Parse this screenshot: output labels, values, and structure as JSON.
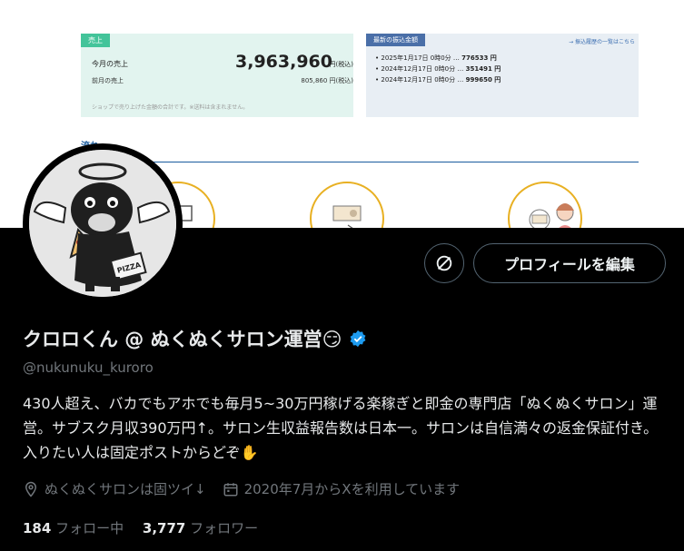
{
  "banner": {
    "sales_tag": "売上",
    "this_month_label": "今月の売上",
    "this_month_value": "3,963,960",
    "this_month_unit": "円(税込)",
    "last_month_label": "前月の売上",
    "last_month_value": "805,860 円(税込)",
    "sales_note": "ショップで売り上げた金額の合計です。※送料は含まれません。",
    "recent_tag": "最新の振込金額",
    "recent_link": "→ 振込履歴の一覧はこちら",
    "recent_items": [
      {
        "date": "2025年1月17日 0時0分 …",
        "amount": "776533 円"
      },
      {
        "date": "2024年12月17日 0時0分 …",
        "amount": "351491 円"
      },
      {
        "date": "2024年12月17日 0時0分 …",
        "amount": "999650 円"
      }
    ],
    "steps_heading": "流れ"
  },
  "profile": {
    "display_name": "クロロくん @ ぬくぬくサロン運営😏",
    "handle": "@nukunuku_kuroro",
    "bio": "430人超え、バカでもアホでも毎月5~30万円稼げる楽稼ぎと即金の専門店「ぬくぬくサロン」運営。サブスク月収390万円↑。サロン生収益報告数は日本一。サロンは自信満々の返金保証付き。入りたい人は固定ポストからどぞ✋",
    "location": "ぬくぬくサロンは固ツイ↓",
    "joined": "2020年7月からXを利用しています",
    "following_count": "184",
    "following_label": "フォロー中",
    "followers_count": "3,777",
    "followers_label": "フォロワー",
    "edit_button": "プロフィールを編集",
    "avatar_text": "PIZZA"
  },
  "colors": {
    "background": "#000000",
    "text_primary": "#e7e9ea",
    "text_secondary": "#71767b",
    "verified": "#1d9bf0"
  }
}
